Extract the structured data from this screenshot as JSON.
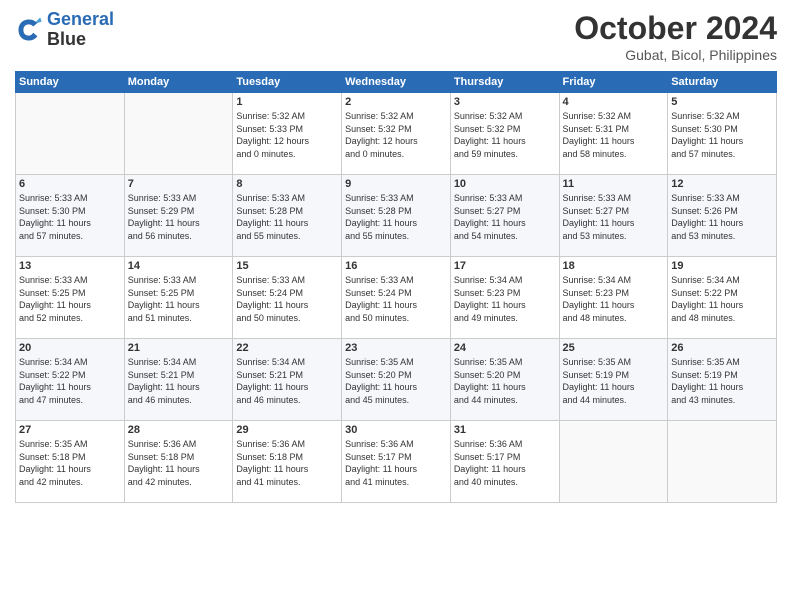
{
  "header": {
    "logo_line1": "General",
    "logo_line2": "Blue",
    "month": "October 2024",
    "location": "Gubat, Bicol, Philippines"
  },
  "weekdays": [
    "Sunday",
    "Monday",
    "Tuesday",
    "Wednesday",
    "Thursday",
    "Friday",
    "Saturday"
  ],
  "weeks": [
    [
      {
        "day": "",
        "info": ""
      },
      {
        "day": "",
        "info": ""
      },
      {
        "day": "1",
        "info": "Sunrise: 5:32 AM\nSunset: 5:33 PM\nDaylight: 12 hours\nand 0 minutes."
      },
      {
        "day": "2",
        "info": "Sunrise: 5:32 AM\nSunset: 5:32 PM\nDaylight: 12 hours\nand 0 minutes."
      },
      {
        "day": "3",
        "info": "Sunrise: 5:32 AM\nSunset: 5:32 PM\nDaylight: 11 hours\nand 59 minutes."
      },
      {
        "day": "4",
        "info": "Sunrise: 5:32 AM\nSunset: 5:31 PM\nDaylight: 11 hours\nand 58 minutes."
      },
      {
        "day": "5",
        "info": "Sunrise: 5:32 AM\nSunset: 5:30 PM\nDaylight: 11 hours\nand 57 minutes."
      }
    ],
    [
      {
        "day": "6",
        "info": "Sunrise: 5:33 AM\nSunset: 5:30 PM\nDaylight: 11 hours\nand 57 minutes."
      },
      {
        "day": "7",
        "info": "Sunrise: 5:33 AM\nSunset: 5:29 PM\nDaylight: 11 hours\nand 56 minutes."
      },
      {
        "day": "8",
        "info": "Sunrise: 5:33 AM\nSunset: 5:28 PM\nDaylight: 11 hours\nand 55 minutes."
      },
      {
        "day": "9",
        "info": "Sunrise: 5:33 AM\nSunset: 5:28 PM\nDaylight: 11 hours\nand 55 minutes."
      },
      {
        "day": "10",
        "info": "Sunrise: 5:33 AM\nSunset: 5:27 PM\nDaylight: 11 hours\nand 54 minutes."
      },
      {
        "day": "11",
        "info": "Sunrise: 5:33 AM\nSunset: 5:27 PM\nDaylight: 11 hours\nand 53 minutes."
      },
      {
        "day": "12",
        "info": "Sunrise: 5:33 AM\nSunset: 5:26 PM\nDaylight: 11 hours\nand 53 minutes."
      }
    ],
    [
      {
        "day": "13",
        "info": "Sunrise: 5:33 AM\nSunset: 5:25 PM\nDaylight: 11 hours\nand 52 minutes."
      },
      {
        "day": "14",
        "info": "Sunrise: 5:33 AM\nSunset: 5:25 PM\nDaylight: 11 hours\nand 51 minutes."
      },
      {
        "day": "15",
        "info": "Sunrise: 5:33 AM\nSunset: 5:24 PM\nDaylight: 11 hours\nand 50 minutes."
      },
      {
        "day": "16",
        "info": "Sunrise: 5:33 AM\nSunset: 5:24 PM\nDaylight: 11 hours\nand 50 minutes."
      },
      {
        "day": "17",
        "info": "Sunrise: 5:34 AM\nSunset: 5:23 PM\nDaylight: 11 hours\nand 49 minutes."
      },
      {
        "day": "18",
        "info": "Sunrise: 5:34 AM\nSunset: 5:23 PM\nDaylight: 11 hours\nand 48 minutes."
      },
      {
        "day": "19",
        "info": "Sunrise: 5:34 AM\nSunset: 5:22 PM\nDaylight: 11 hours\nand 48 minutes."
      }
    ],
    [
      {
        "day": "20",
        "info": "Sunrise: 5:34 AM\nSunset: 5:22 PM\nDaylight: 11 hours\nand 47 minutes."
      },
      {
        "day": "21",
        "info": "Sunrise: 5:34 AM\nSunset: 5:21 PM\nDaylight: 11 hours\nand 46 minutes."
      },
      {
        "day": "22",
        "info": "Sunrise: 5:34 AM\nSunset: 5:21 PM\nDaylight: 11 hours\nand 46 minutes."
      },
      {
        "day": "23",
        "info": "Sunrise: 5:35 AM\nSunset: 5:20 PM\nDaylight: 11 hours\nand 45 minutes."
      },
      {
        "day": "24",
        "info": "Sunrise: 5:35 AM\nSunset: 5:20 PM\nDaylight: 11 hours\nand 44 minutes."
      },
      {
        "day": "25",
        "info": "Sunrise: 5:35 AM\nSunset: 5:19 PM\nDaylight: 11 hours\nand 44 minutes."
      },
      {
        "day": "26",
        "info": "Sunrise: 5:35 AM\nSunset: 5:19 PM\nDaylight: 11 hours\nand 43 minutes."
      }
    ],
    [
      {
        "day": "27",
        "info": "Sunrise: 5:35 AM\nSunset: 5:18 PM\nDaylight: 11 hours\nand 42 minutes."
      },
      {
        "day": "28",
        "info": "Sunrise: 5:36 AM\nSunset: 5:18 PM\nDaylight: 11 hours\nand 42 minutes."
      },
      {
        "day": "29",
        "info": "Sunrise: 5:36 AM\nSunset: 5:18 PM\nDaylight: 11 hours\nand 41 minutes."
      },
      {
        "day": "30",
        "info": "Sunrise: 5:36 AM\nSunset: 5:17 PM\nDaylight: 11 hours\nand 41 minutes."
      },
      {
        "day": "31",
        "info": "Sunrise: 5:36 AM\nSunset: 5:17 PM\nDaylight: 11 hours\nand 40 minutes."
      },
      {
        "day": "",
        "info": ""
      },
      {
        "day": "",
        "info": ""
      }
    ]
  ]
}
